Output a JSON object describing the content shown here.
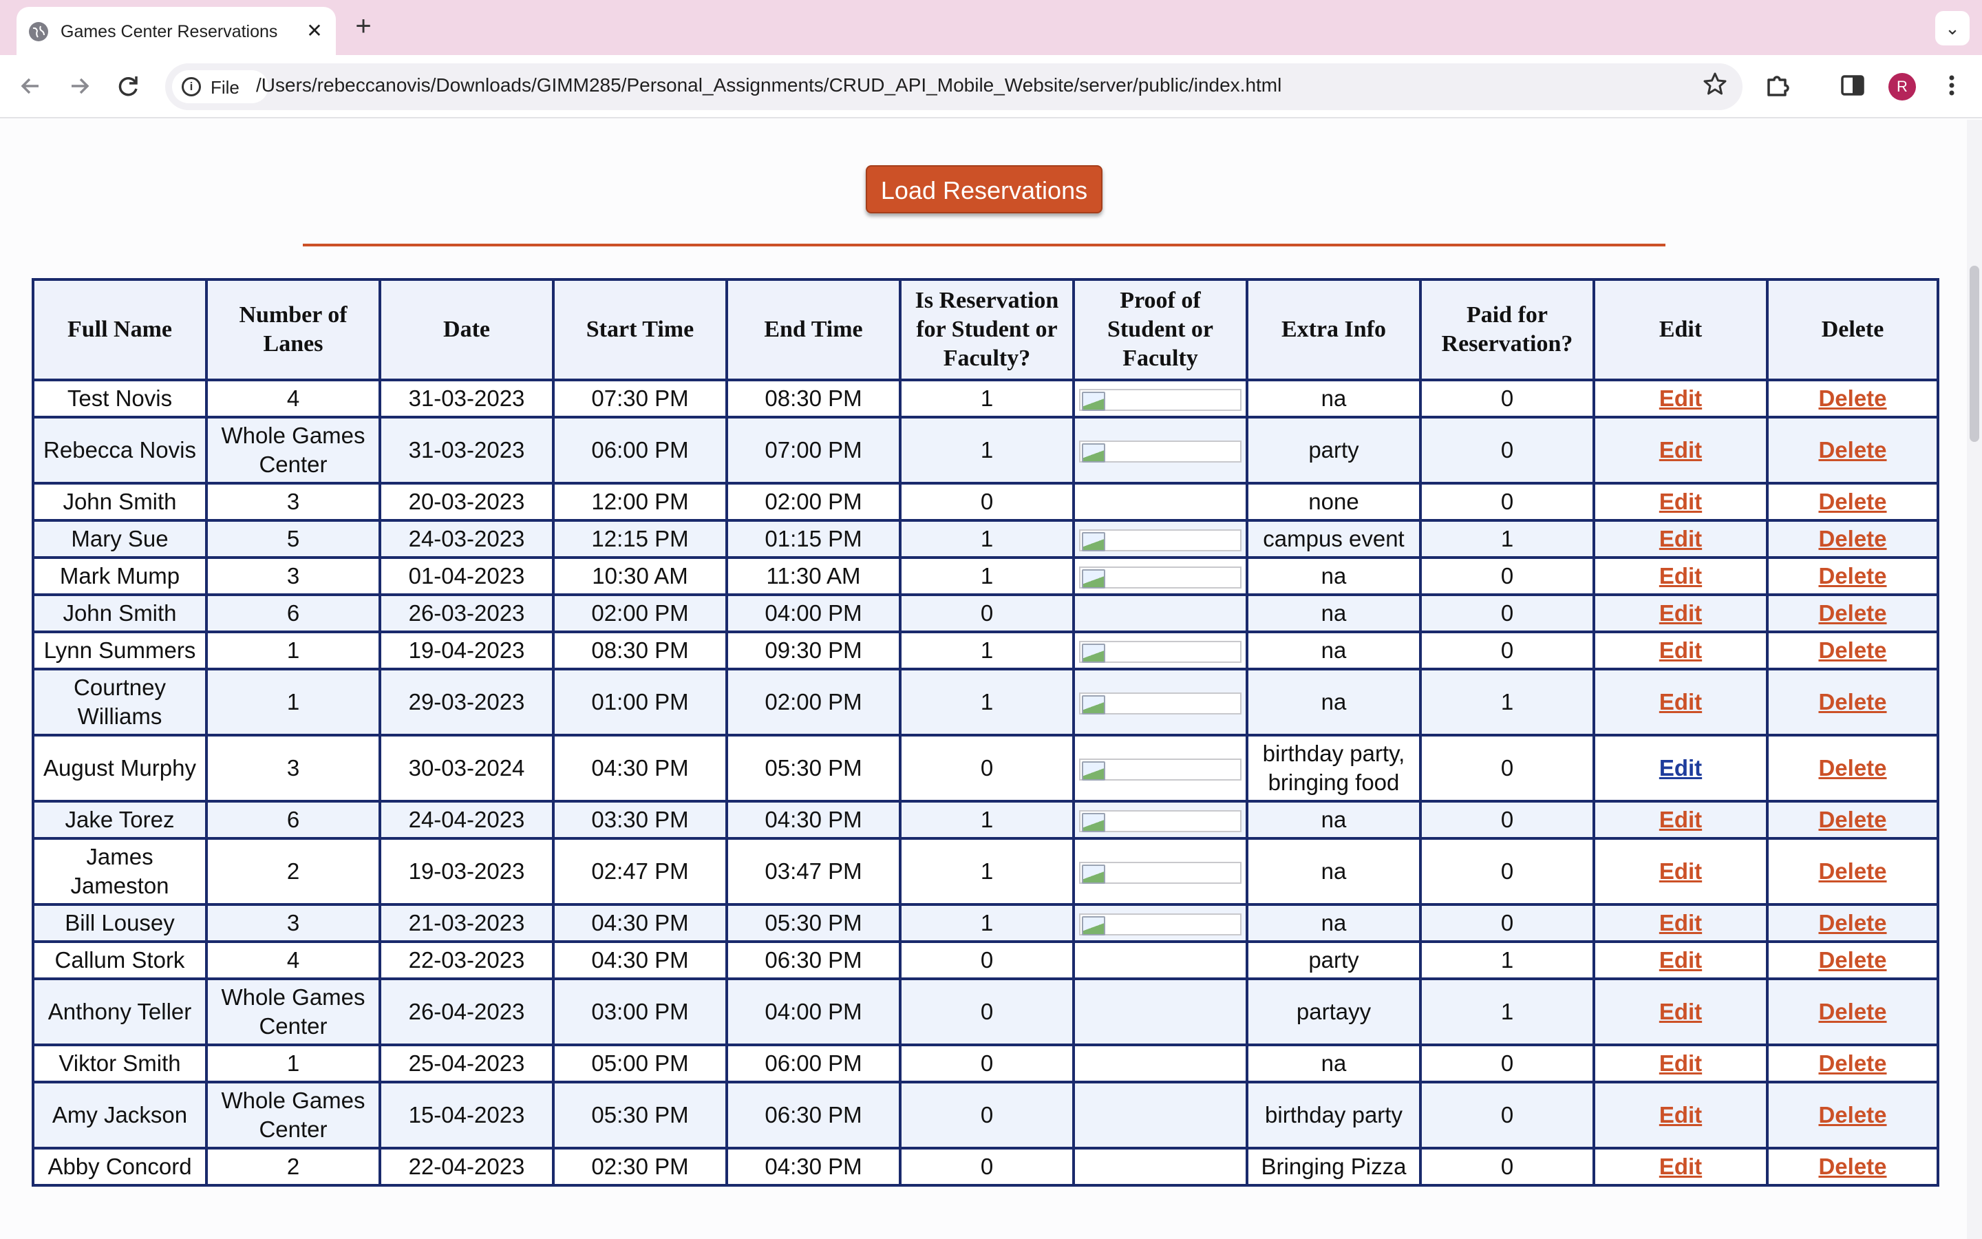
{
  "browser": {
    "tab_title": "Games Center Reservations",
    "tab_close": "✕",
    "new_tab": "+",
    "tabs_menu": "⌄",
    "site_chip_label": "File",
    "url": "/Users/rebeccanovis/Downloads/GIMM285/Personal_Assignments/CRUD_API_Mobile_Website/server/public/index.html",
    "profile_initial": "R",
    "accent_color": "#f2d7e6"
  },
  "page": {
    "load_button_label": "Load Reservations",
    "accent_color": "#cc5127",
    "table_border_color": "#1a2a6c"
  },
  "table": {
    "headers": [
      "Full Name",
      "Number of Lanes",
      "Date",
      "Start Time",
      "End Time",
      "Is Reservation for Student or Faculty?",
      "Proof of Student or Faculty",
      "Extra Info",
      "Paid for Reservation?",
      "Edit",
      "Delete"
    ],
    "edit_label": "Edit",
    "delete_label": "Delete",
    "rows": [
      {
        "name": "Test Novis",
        "lanes": "4",
        "date": "31-03-2023",
        "start": "07:30 PM",
        "end": "08:30 PM",
        "student": "1",
        "proof": true,
        "extra": "na",
        "paid": "0"
      },
      {
        "name": "Rebecca Novis",
        "lanes": "Whole Games Center",
        "date": "31-03-2023",
        "start": "06:00 PM",
        "end": "07:00 PM",
        "student": "1",
        "proof": true,
        "extra": "party",
        "paid": "0"
      },
      {
        "name": "John Smith",
        "lanes": "3",
        "date": "20-03-2023",
        "start": "12:00 PM",
        "end": "02:00 PM",
        "student": "0",
        "proof": false,
        "extra": "none",
        "paid": "0"
      },
      {
        "name": "Mary Sue",
        "lanes": "5",
        "date": "24-03-2023",
        "start": "12:15 PM",
        "end": "01:15 PM",
        "student": "1",
        "proof": true,
        "extra": "campus event",
        "paid": "1"
      },
      {
        "name": "Mark Mump",
        "lanes": "3",
        "date": "01-04-2023",
        "start": "10:30 AM",
        "end": "11:30 AM",
        "student": "1",
        "proof": true,
        "extra": "na",
        "paid": "0"
      },
      {
        "name": "John Smith",
        "lanes": "6",
        "date": "26-03-2023",
        "start": "02:00 PM",
        "end": "04:00 PM",
        "student": "0",
        "proof": false,
        "extra": "na",
        "paid": "0"
      },
      {
        "name": "Lynn Summers",
        "lanes": "1",
        "date": "19-04-2023",
        "start": "08:30 PM",
        "end": "09:30 PM",
        "student": "1",
        "proof": true,
        "extra": "na",
        "paid": "0"
      },
      {
        "name": "Courtney Williams",
        "lanes": "1",
        "date": "29-03-2023",
        "start": "01:00 PM",
        "end": "02:00 PM",
        "student": "1",
        "proof": true,
        "extra": "na",
        "paid": "1"
      },
      {
        "name": "August Murphy",
        "lanes": "3",
        "date": "30-03-2024",
        "start": "04:30 PM",
        "end": "05:30 PM",
        "student": "0",
        "proof": true,
        "extra": "birthday party, bringing food",
        "paid": "0",
        "edit_visited": true
      },
      {
        "name": "Jake Torez",
        "lanes": "6",
        "date": "24-04-2023",
        "start": "03:30 PM",
        "end": "04:30 PM",
        "student": "1",
        "proof": true,
        "extra": "na",
        "paid": "0"
      },
      {
        "name": "James Jameston",
        "lanes": "2",
        "date": "19-03-2023",
        "start": "02:47 PM",
        "end": "03:47 PM",
        "student": "1",
        "proof": true,
        "extra": "na",
        "paid": "0"
      },
      {
        "name": "Bill Lousey",
        "lanes": "3",
        "date": "21-03-2023",
        "start": "04:30 PM",
        "end": "05:30 PM",
        "student": "1",
        "proof": true,
        "extra": "na",
        "paid": "0"
      },
      {
        "name": "Callum Stork",
        "lanes": "4",
        "date": "22-03-2023",
        "start": "04:30 PM",
        "end": "06:30 PM",
        "student": "0",
        "proof": false,
        "extra": "party",
        "paid": "1"
      },
      {
        "name": "Anthony Teller",
        "lanes": "Whole Games Center",
        "date": "26-04-2023",
        "start": "03:00 PM",
        "end": "04:00 PM",
        "student": "0",
        "proof": false,
        "extra": "partayy",
        "paid": "1"
      },
      {
        "name": "Viktor Smith",
        "lanes": "1",
        "date": "25-04-2023",
        "start": "05:00 PM",
        "end": "06:00 PM",
        "student": "0",
        "proof": false,
        "extra": "na",
        "paid": "0"
      },
      {
        "name": "Amy Jackson",
        "lanes": "Whole Games Center",
        "date": "15-04-2023",
        "start": "05:30 PM",
        "end": "06:30 PM",
        "student": "0",
        "proof": false,
        "extra": "birthday party",
        "paid": "0"
      },
      {
        "name": "Abby Concord",
        "lanes": "2",
        "date": "22-04-2023",
        "start": "02:30 PM",
        "end": "04:30 PM",
        "student": "0",
        "proof": false,
        "extra": "Bringing Pizza",
        "paid": "0"
      }
    ]
  }
}
